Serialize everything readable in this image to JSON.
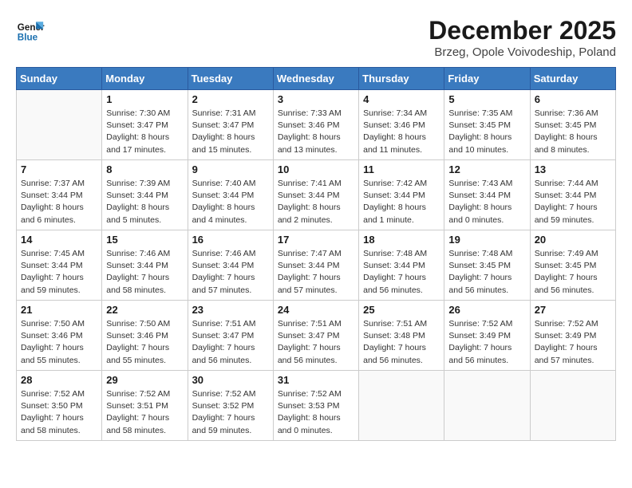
{
  "header": {
    "logo_line1": "General",
    "logo_line2": "Blue",
    "month_title": "December 2025",
    "subtitle": "Brzeg, Opole Voivodeship, Poland"
  },
  "days_of_week": [
    "Sunday",
    "Monday",
    "Tuesday",
    "Wednesday",
    "Thursday",
    "Friday",
    "Saturday"
  ],
  "weeks": [
    [
      {
        "day": "",
        "info": []
      },
      {
        "day": "1",
        "info": [
          "Sunrise: 7:30 AM",
          "Sunset: 3:47 PM",
          "Daylight: 8 hours",
          "and 17 minutes."
        ]
      },
      {
        "day": "2",
        "info": [
          "Sunrise: 7:31 AM",
          "Sunset: 3:47 PM",
          "Daylight: 8 hours",
          "and 15 minutes."
        ]
      },
      {
        "day": "3",
        "info": [
          "Sunrise: 7:33 AM",
          "Sunset: 3:46 PM",
          "Daylight: 8 hours",
          "and 13 minutes."
        ]
      },
      {
        "day": "4",
        "info": [
          "Sunrise: 7:34 AM",
          "Sunset: 3:46 PM",
          "Daylight: 8 hours",
          "and 11 minutes."
        ]
      },
      {
        "day": "5",
        "info": [
          "Sunrise: 7:35 AM",
          "Sunset: 3:45 PM",
          "Daylight: 8 hours",
          "and 10 minutes."
        ]
      },
      {
        "day": "6",
        "info": [
          "Sunrise: 7:36 AM",
          "Sunset: 3:45 PM",
          "Daylight: 8 hours",
          "and 8 minutes."
        ]
      }
    ],
    [
      {
        "day": "7",
        "info": [
          "Sunrise: 7:37 AM",
          "Sunset: 3:44 PM",
          "Daylight: 8 hours",
          "and 6 minutes."
        ]
      },
      {
        "day": "8",
        "info": [
          "Sunrise: 7:39 AM",
          "Sunset: 3:44 PM",
          "Daylight: 8 hours",
          "and 5 minutes."
        ]
      },
      {
        "day": "9",
        "info": [
          "Sunrise: 7:40 AM",
          "Sunset: 3:44 PM",
          "Daylight: 8 hours",
          "and 4 minutes."
        ]
      },
      {
        "day": "10",
        "info": [
          "Sunrise: 7:41 AM",
          "Sunset: 3:44 PM",
          "Daylight: 8 hours",
          "and 2 minutes."
        ]
      },
      {
        "day": "11",
        "info": [
          "Sunrise: 7:42 AM",
          "Sunset: 3:44 PM",
          "Daylight: 8 hours",
          "and 1 minute."
        ]
      },
      {
        "day": "12",
        "info": [
          "Sunrise: 7:43 AM",
          "Sunset: 3:44 PM",
          "Daylight: 8 hours",
          "and 0 minutes."
        ]
      },
      {
        "day": "13",
        "info": [
          "Sunrise: 7:44 AM",
          "Sunset: 3:44 PM",
          "Daylight: 7 hours",
          "and 59 minutes."
        ]
      }
    ],
    [
      {
        "day": "14",
        "info": [
          "Sunrise: 7:45 AM",
          "Sunset: 3:44 PM",
          "Daylight: 7 hours",
          "and 59 minutes."
        ]
      },
      {
        "day": "15",
        "info": [
          "Sunrise: 7:46 AM",
          "Sunset: 3:44 PM",
          "Daylight: 7 hours",
          "and 58 minutes."
        ]
      },
      {
        "day": "16",
        "info": [
          "Sunrise: 7:46 AM",
          "Sunset: 3:44 PM",
          "Daylight: 7 hours",
          "and 57 minutes."
        ]
      },
      {
        "day": "17",
        "info": [
          "Sunrise: 7:47 AM",
          "Sunset: 3:44 PM",
          "Daylight: 7 hours",
          "and 57 minutes."
        ]
      },
      {
        "day": "18",
        "info": [
          "Sunrise: 7:48 AM",
          "Sunset: 3:44 PM",
          "Daylight: 7 hours",
          "and 56 minutes."
        ]
      },
      {
        "day": "19",
        "info": [
          "Sunrise: 7:48 AM",
          "Sunset: 3:45 PM",
          "Daylight: 7 hours",
          "and 56 minutes."
        ]
      },
      {
        "day": "20",
        "info": [
          "Sunrise: 7:49 AM",
          "Sunset: 3:45 PM",
          "Daylight: 7 hours",
          "and 56 minutes."
        ]
      }
    ],
    [
      {
        "day": "21",
        "info": [
          "Sunrise: 7:50 AM",
          "Sunset: 3:46 PM",
          "Daylight: 7 hours",
          "and 55 minutes."
        ]
      },
      {
        "day": "22",
        "info": [
          "Sunrise: 7:50 AM",
          "Sunset: 3:46 PM",
          "Daylight: 7 hours",
          "and 55 minutes."
        ]
      },
      {
        "day": "23",
        "info": [
          "Sunrise: 7:51 AM",
          "Sunset: 3:47 PM",
          "Daylight: 7 hours",
          "and 56 minutes."
        ]
      },
      {
        "day": "24",
        "info": [
          "Sunrise: 7:51 AM",
          "Sunset: 3:47 PM",
          "Daylight: 7 hours",
          "and 56 minutes."
        ]
      },
      {
        "day": "25",
        "info": [
          "Sunrise: 7:51 AM",
          "Sunset: 3:48 PM",
          "Daylight: 7 hours",
          "and 56 minutes."
        ]
      },
      {
        "day": "26",
        "info": [
          "Sunrise: 7:52 AM",
          "Sunset: 3:49 PM",
          "Daylight: 7 hours",
          "and 56 minutes."
        ]
      },
      {
        "day": "27",
        "info": [
          "Sunrise: 7:52 AM",
          "Sunset: 3:49 PM",
          "Daylight: 7 hours",
          "and 57 minutes."
        ]
      }
    ],
    [
      {
        "day": "28",
        "info": [
          "Sunrise: 7:52 AM",
          "Sunset: 3:50 PM",
          "Daylight: 7 hours",
          "and 58 minutes."
        ]
      },
      {
        "day": "29",
        "info": [
          "Sunrise: 7:52 AM",
          "Sunset: 3:51 PM",
          "Daylight: 7 hours",
          "and 58 minutes."
        ]
      },
      {
        "day": "30",
        "info": [
          "Sunrise: 7:52 AM",
          "Sunset: 3:52 PM",
          "Daylight: 7 hours",
          "and 59 minutes."
        ]
      },
      {
        "day": "31",
        "info": [
          "Sunrise: 7:52 AM",
          "Sunset: 3:53 PM",
          "Daylight: 8 hours",
          "and 0 minutes."
        ]
      },
      {
        "day": "",
        "info": []
      },
      {
        "day": "",
        "info": []
      },
      {
        "day": "",
        "info": []
      }
    ]
  ]
}
